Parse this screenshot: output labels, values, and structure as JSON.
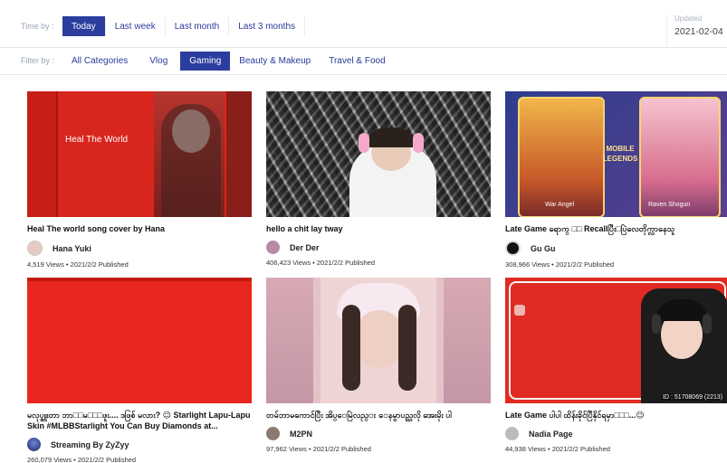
{
  "time_filter": {
    "label": "Time by :",
    "options": [
      "Today",
      "Last week",
      "Last month",
      "Last 3 months"
    ],
    "selected": "Today"
  },
  "updated": {
    "label": "Updated",
    "date": "2021-02-04"
  },
  "category_filter": {
    "label": "Filter by :",
    "options": [
      "All Categories",
      "Vlog",
      "Gaming",
      "Beauty & Makeup",
      "Travel & Food"
    ],
    "selected": "Gaming"
  },
  "videos": [
    {
      "title": "Heal The world song cover by Hana",
      "author": "Hana Yuki",
      "views": "4,519 Views",
      "published": "2021/2/2 Published",
      "overlay_text": "Heal The World"
    },
    {
      "title": "hello a chit lay tway",
      "author": "Der Der",
      "views": "406,423 Views",
      "published": "2021/2/2 Published"
    },
    {
      "title": "Late Game ရောက္ □□ Recallပြီး□ပြဲလေတိုက္လာနေသူ",
      "author": "Gu Gu",
      "views": "308,966 Views",
      "published": "2021/2/2 Published",
      "game_logo": "MOBILE LEGENDS",
      "hero_left": "War Angel",
      "hero_right": "Raven Shogun"
    },
    {
      "title": "မလုပ္ဖူးတာ ဘာ□□မ□□□ဖူး.... ဒဖြစ် မလား? 😉 Starlight Lapu-Lapu Skin #MLBBStarlight You Can Buy Diamonds at...",
      "author": "Streaming By ZyZyy",
      "views": "260,079 Views",
      "published": "2021/2/2 Published"
    },
    {
      "title": "တမ်ဘာမကောင်ပြီး အိပ္ေမြဲလည္း ေနမွာပည္သလို အေးမိုး ပါ",
      "author": "M2PN",
      "views": "97,962 Views",
      "published": "2021/2/2 Published"
    },
    {
      "title": "Late Game ပါပါ ထိန်းခိုင်ပြီနိုင်ရမှာ□□□...😉",
      "author": "Nadia Page",
      "views": "44,938 Views",
      "published": "2021/2/2 Published",
      "overlay_text": "ID : 51708069 (2213)"
    }
  ]
}
